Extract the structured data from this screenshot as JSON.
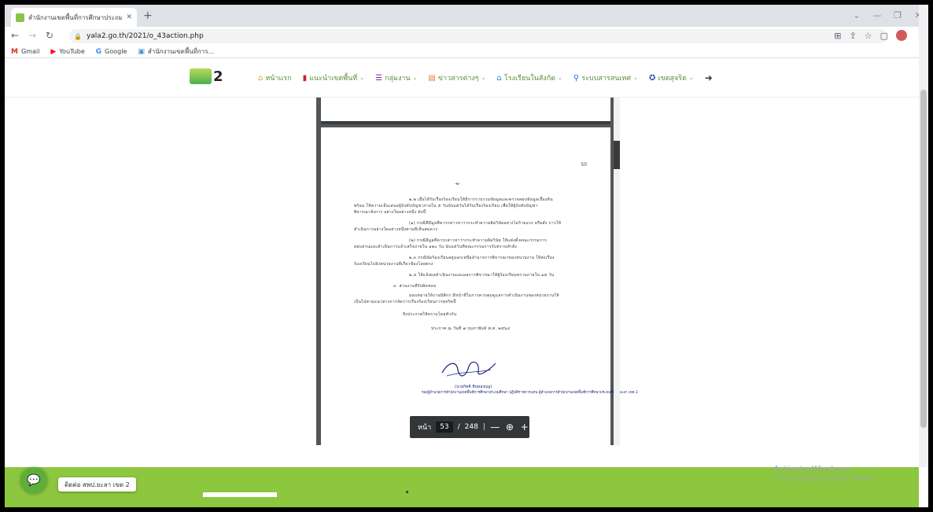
{
  "browser": {
    "tab_title": "สำนักงานเขตพื้นที่การศึกษาประถมศึก",
    "new_tab": "+",
    "url": "yala2.go.th/2021/o_43action.php"
  },
  "bookmarks": [
    {
      "label": "Gmail"
    },
    {
      "label": "YouTube"
    },
    {
      "label": "Google"
    },
    {
      "label": "สำนักงานเขตพื้นที่การ..."
    }
  ],
  "site": {
    "logo_number": "2",
    "menu": [
      {
        "label": "หน้าแรก",
        "dropdown": false
      },
      {
        "label": "แนะนำเขตพื้นที่",
        "dropdown": true
      },
      {
        "label": "กลุ่มงาน",
        "dropdown": true
      },
      {
        "label": "ข่าวสารต่างๆ",
        "dropdown": true
      },
      {
        "label": "โรงเรียนในสังกัด",
        "dropdown": true
      },
      {
        "label": "ระบบสารสนเทศ",
        "dropdown": true
      },
      {
        "label": "เขตสุจริต",
        "dropdown": true
      }
    ]
  },
  "document": {
    "page_number_mark": "50",
    "header_mark": "-๒-",
    "lines": [
      "๒.๒ เมื่อได้รับเรื่องร้องเรียนให้มีการรวบรวมข้อมูลและตรวจสอบข้อมูลเบื้องต้น",
      "พร้อม ให้ความเห็นเสนอผู้บังคับบัญชาภายใน ๕ วันนับแต่วันได้รับเรื่องร้องเรียน เพื่อให้ผู้บังคับบัญชา",
      "พิจารณาสั่งการ อย่างใดอย่างหนึ่ง ดังนี้",
      "(๑) กรณีที่มีมูลที่ควรกล่าวหาว่ากระทำความผิดวินัยอย่างไม่ร้ายแรง หรือสั่ง การให้",
      "ดำเนินการอย่างใดอย่างหนึ่งตามที่เห็นสมควร",
      "(๒) กรณีมีมูลที่ควรกล่าวหาว่ากระทำความผิดวินัย ให้แต่งตั้งคณะกรรมการ",
      "สอบสวนและดำเนินการแล้วเสร็จภายใน ๑๒๐ วัน นับแต่วันที่คณะกรรมการรับทราบคำสั่ง",
      "๒.๓ กรณีข้อร้องเรียนอยู่นอกเหนืออำนาจการพิจารณาของหน่วยงาน ให้ส่งเรื่อง",
      "ร้องเรียนไปยังหน่วยงานที่เกี่ยวข้องโดยตรง",
      "๒.๔ ให้แจ้งผลดำเนินงานและผลการพิจารณาให้ผู้ร้องเรียนทราบภายใน ๑๕ วัน",
      "๓. ส่วนงานที่รับผิดชอบ",
      "มอบหมายให้งานนิติกร มีหน้าที่ในการควบคุมดูแลการดำเนินงานของหน่วยงานให้",
      "เป็นไปตามแนวทางการจัดการเรื่องร้องเรียนการทุจริตนี้",
      "จึงประกาศให้ทราบโดยทั่วกัน",
      "ประกาศ ณ วันที่ ๗ กุมภาพันธ์ พ.ศ. ๒๕๖๔"
    ],
    "signer_name": "(นายกิตติ ชินทองบุญ)",
    "signer_title": "รองผู้อำนวยการสำนักงานเขตพื้นที่การศึกษาประถมศึกษา ปฏิบัติราชการแทน ผู้อำนวยการสำนักงานเขตพื้นที่การศึกษาประถมศึกษายะลา เขต 2"
  },
  "pdf_toolbar": {
    "page_label": "หน้า",
    "current_page": "53",
    "separator": "/",
    "total_pages": "248"
  },
  "chat": {
    "label": "ติดต่อ สพป.ยะลา เขต 2"
  },
  "watermark": {
    "line1": "Activate Windows",
    "line2": "Go to Settings to activate Windows."
  }
}
